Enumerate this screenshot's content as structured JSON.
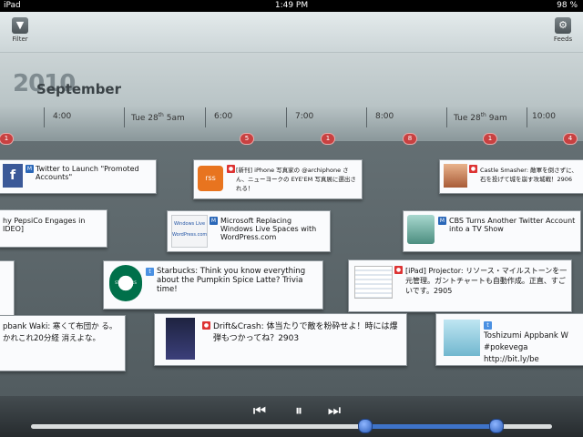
{
  "status": {
    "carrier": "iPad",
    "time": "1:49 PM",
    "battery": "98 %"
  },
  "toolbar": {
    "filter_label": "Filter",
    "feeds_label": "Feeds"
  },
  "timeline": {
    "year": "2010",
    "month": "September",
    "labels": [
      {
        "text": "4:00"
      },
      {
        "text": "Tue 28",
        "sup": "th",
        "tail": "5am"
      },
      {
        "text": "6:00"
      },
      {
        "text": "7:00"
      },
      {
        "text": "8:00"
      },
      {
        "text": "Tue 28",
        "sup": "th",
        "tail": "9am"
      },
      {
        "text": "10:00"
      }
    ],
    "badges": [
      "1",
      "5",
      "1",
      "8",
      "1",
      "4"
    ]
  },
  "cards": [
    {
      "text": "Twitter to Launch \"Promoted Accounts\""
    },
    {
      "text": "[新刊] iPhone 写真家の @archiphone さん、ニューヨークの EYE'EM 写真展に選出される！"
    },
    {
      "text": "Castle Smasher: 敵軍を倒さずに、石を投げて城を崩す攻城戦！2906"
    },
    {
      "text": "hy PepsiCo Engages in IDEO]"
    },
    {
      "text": "Microsoft Replacing Windows Live Spaces with WordPress.com"
    },
    {
      "text": "CBS Turns Another Twitter Account into a TV Show"
    },
    {
      "text": "Starbucks: Think you know everything about the Pumpkin Spice Latte? Trivia time!"
    },
    {
      "text": "[iPad] Projector: リソース・マイルストーンを一元管理。ガントチャートも自動作成。正直、すごいです。2905"
    },
    {
      "text": "pbank Waki: 寒くて布団か る。かれこれ20分経 消えよな。"
    },
    {
      "text": "Drift&Crash: 体当たりで敵を粉砕せよ！時には爆弾もつかってね？2903"
    },
    {
      "text": "Toshizumi Appbank W #pokevega http://bit.ly/be"
    }
  ],
  "icons": {
    "facebook": "f",
    "rss": "rss",
    "windows_live_caption": "Windows Live",
    "wordpress_caption": "WordPress.com",
    "starbucks": "STARBUCKS COFFEE"
  },
  "colors": {
    "badge": "#c84141",
    "range": "#3e73c9"
  }
}
